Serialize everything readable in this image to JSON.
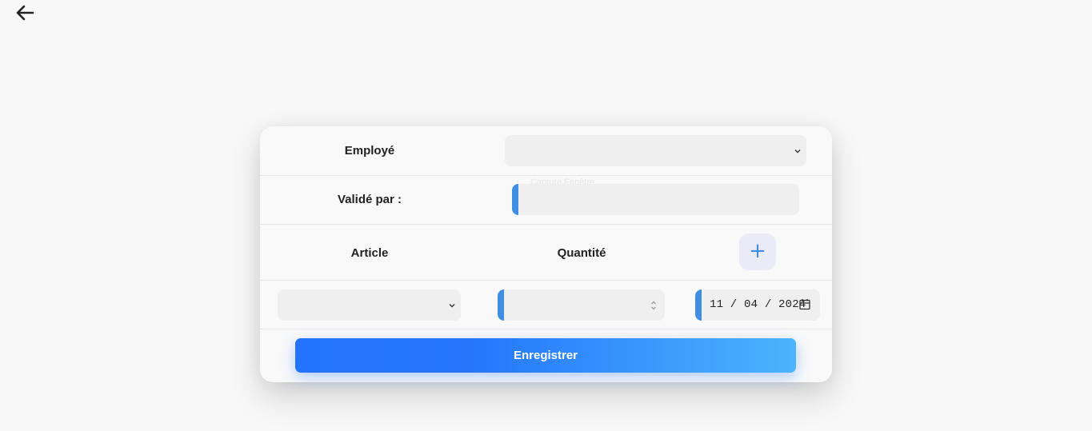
{
  "nav": {
    "back_icon": "arrow-left-icon"
  },
  "form": {
    "employee_label": "Employé",
    "employee_value": "",
    "employee_hint": "Capture Fenêtre",
    "validated_by_label": "Validé par :",
    "validated_by_value": "",
    "article_header": "Article",
    "quantity_header": "Quantité",
    "add_icon": "plus-icon",
    "add_symbol": "+",
    "article_value": "",
    "quantity_value": "",
    "date": {
      "month": "11",
      "day": "04",
      "year": "2024",
      "icon": "calendar-icon"
    },
    "submit_label": "Enregistrer"
  },
  "colors": {
    "accent": "#3f8ee3",
    "submit_gradient_start": "#2373ff",
    "submit_gradient_end": "#4bb4fd",
    "field_bg": "#efefef",
    "page_bg": "#f8f8f8"
  }
}
